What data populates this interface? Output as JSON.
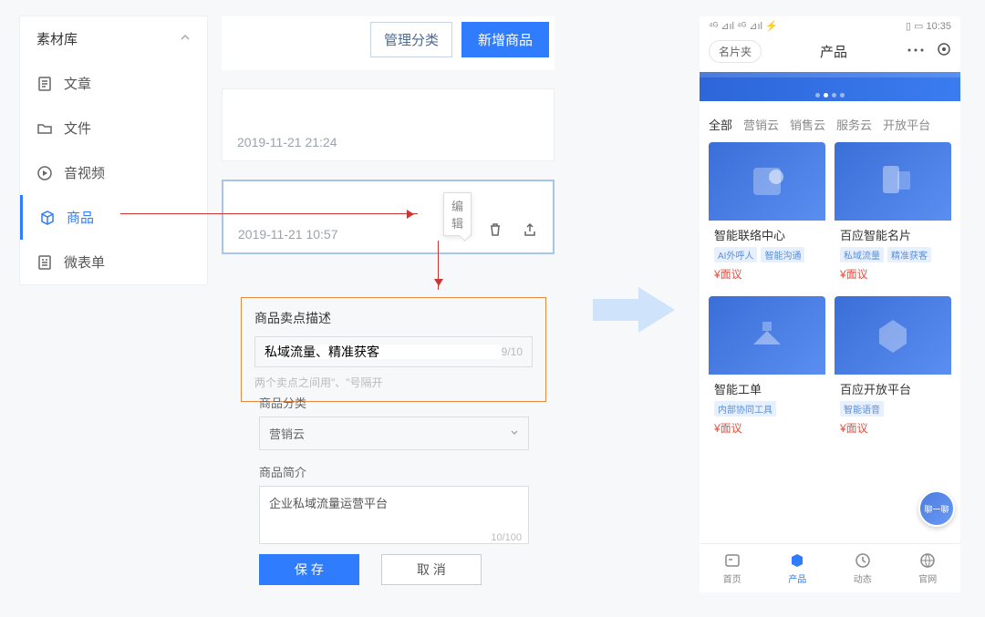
{
  "sidebar": {
    "title": "素材库",
    "items": [
      {
        "label": "文章",
        "icon": "article-icon"
      },
      {
        "label": "文件",
        "icon": "folder-icon"
      },
      {
        "label": "音视频",
        "icon": "play-icon"
      },
      {
        "label": "商品",
        "icon": "cube-icon",
        "active": true
      },
      {
        "label": "微表单",
        "icon": "form-icon"
      }
    ]
  },
  "mid": {
    "manage_label": "管理分类",
    "new_label": "新增商品",
    "entries": [
      {
        "time": "2019-11-21 21:24"
      },
      {
        "time": "2019-11-21 10:57",
        "active": true
      }
    ],
    "edit_tooltip": "编辑"
  },
  "form": {
    "desc_label": "商品卖点描述",
    "desc_value": "私域流量、精准获客",
    "desc_counter": "9/10",
    "desc_hint": "两个卖点之间用\"、\"号隔开",
    "cat_label": "商品分类",
    "cat_value": "营销云",
    "intro_label": "商品简介",
    "intro_value": "企业私域流量运营平台",
    "intro_counter": "10/100",
    "save_label": "保 存",
    "cancel_label": "取 消"
  },
  "phone": {
    "status": {
      "signal": "⁴ᴳ ⊿ıl ⁴ᴳ ⊿ıl ⚡",
      "right": "▯ ▭ 10:35"
    },
    "top_pill": "名片夹",
    "top_title": "产品",
    "cat_tabs": [
      "全部",
      "营销云",
      "销售云",
      "服务云",
      "开放平台"
    ],
    "products": [
      {
        "title": "智能联络中心",
        "tags": [
          "AI外呼人",
          "智能沟通"
        ],
        "price": "¥面议"
      },
      {
        "title": "百应智能名片",
        "tags": [
          "私域流量",
          "精准获客"
        ],
        "price": "¥面议"
      },
      {
        "title": "智能工单",
        "tags": [
          "内部协同工具"
        ],
        "price": "¥面议"
      },
      {
        "title": "百应开放平台",
        "tags": [
          "智能语音"
        ],
        "price": "¥面议"
      }
    ],
    "nav": [
      {
        "label": "首页"
      },
      {
        "label": "产品",
        "active": true
      },
      {
        "label": "动态"
      },
      {
        "label": "官网"
      }
    ]
  }
}
